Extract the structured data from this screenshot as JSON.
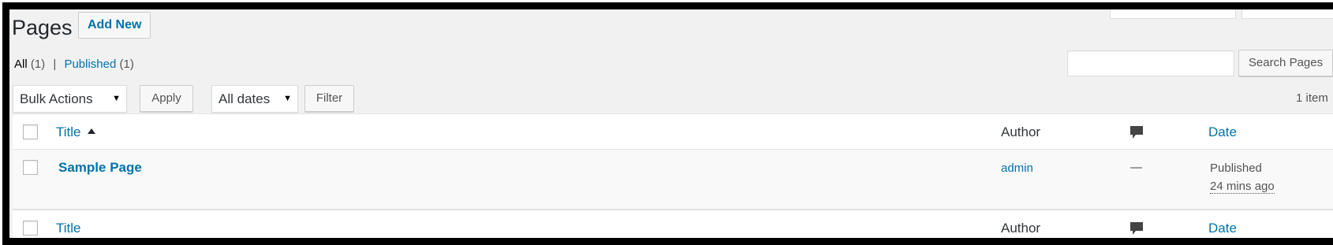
{
  "header": {
    "title": "Pages",
    "add_new_label": "Add New"
  },
  "views": {
    "all_label": "All",
    "all_count": "(1)",
    "separator": "|",
    "published_label": "Published",
    "published_count": "(1)"
  },
  "search": {
    "button_label": "Search Pages",
    "value": "",
    "placeholder": ""
  },
  "bulk": {
    "selected": "Bulk Actions",
    "apply_label": "Apply"
  },
  "dates": {
    "selected": "All dates",
    "filter_label": "Filter"
  },
  "pagination": {
    "items_text": "1 item"
  },
  "table": {
    "columns": {
      "title": "Title",
      "author": "Author",
      "comments_icon": "comment-bubble-icon",
      "date": "Date"
    },
    "rows": [
      {
        "title": "Sample Page",
        "author": "admin",
        "comments": "—",
        "status": "Published",
        "time": "24 mins ago"
      }
    ]
  },
  "colors": {
    "link": "#0073aa",
    "background": "#f1f1f1",
    "text": "#23282d"
  }
}
